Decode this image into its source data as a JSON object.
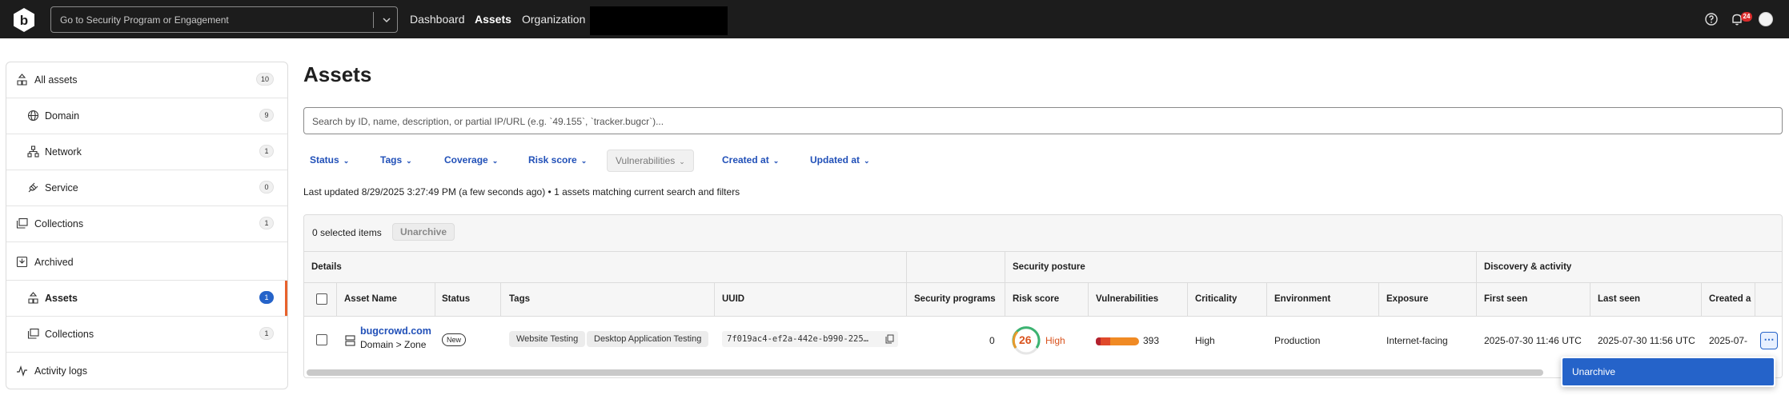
{
  "topbar": {
    "program_placeholder": "Go to Security Program or Engagement",
    "nav": [
      "Dashboard",
      "Assets",
      "Organization"
    ],
    "notification_count": "24"
  },
  "sidebar": {
    "items": [
      {
        "label": "All assets",
        "count": "10"
      },
      {
        "label": "Domain",
        "count": "9"
      },
      {
        "label": "Network",
        "count": "1"
      },
      {
        "label": "Service",
        "count": "0"
      },
      {
        "label": "Collections",
        "count": "1"
      },
      {
        "label": "Archived"
      },
      {
        "label": "Assets",
        "count": "1"
      },
      {
        "label": "Collections",
        "count": "1"
      },
      {
        "label": "Activity logs"
      }
    ]
  },
  "main": {
    "title": "Assets",
    "search_placeholder": "Search by ID, name, description, or partial IP/URL (e.g. `49.155`, `tracker.bugcr`)...",
    "filters": [
      "Status",
      "Tags",
      "Coverage",
      "Risk score",
      "Vulnerabilities",
      "Created at",
      "Updated at"
    ],
    "status_line": "Last updated 8/29/2025 3:27:49 PM (a few seconds ago) • 1 assets matching current search and filters",
    "selected_items": "0 selected items",
    "unarchive_label": "Unarchive"
  },
  "table": {
    "groups": [
      "Details",
      "Security posture",
      "Discovery & activity"
    ],
    "columns": [
      "Asset Name",
      "Status",
      "Tags",
      "UUID",
      "Security programs",
      "Risk score",
      "Vulnerabilities",
      "Criticality",
      "Environment",
      "Exposure",
      "First seen",
      "Last seen",
      "Created a"
    ],
    "row": {
      "name": "bugcrowd.com",
      "type": "Domain > Zone",
      "status": "New",
      "tags": [
        "Website Testing",
        "Desktop Application Testing"
      ],
      "uuid": "7f019ac4-ef2a-442e-b990-225…",
      "security_programs": "0",
      "risk_score": "26",
      "risk_level": "High",
      "vulnerabilities": "393",
      "criticality": "High",
      "environment": "Production",
      "exposure": "Internet-facing",
      "first_seen": "2025-07-30 11:46 UTC",
      "last_seen": "2025-07-30 11:56 UTC",
      "created": "2025-07-"
    }
  },
  "menu": {
    "options": [
      "Unarchive"
    ]
  },
  "colors": {
    "accent": "#2563c9",
    "active_bar": "#e8622c",
    "risk_high": "#d9531e"
  }
}
